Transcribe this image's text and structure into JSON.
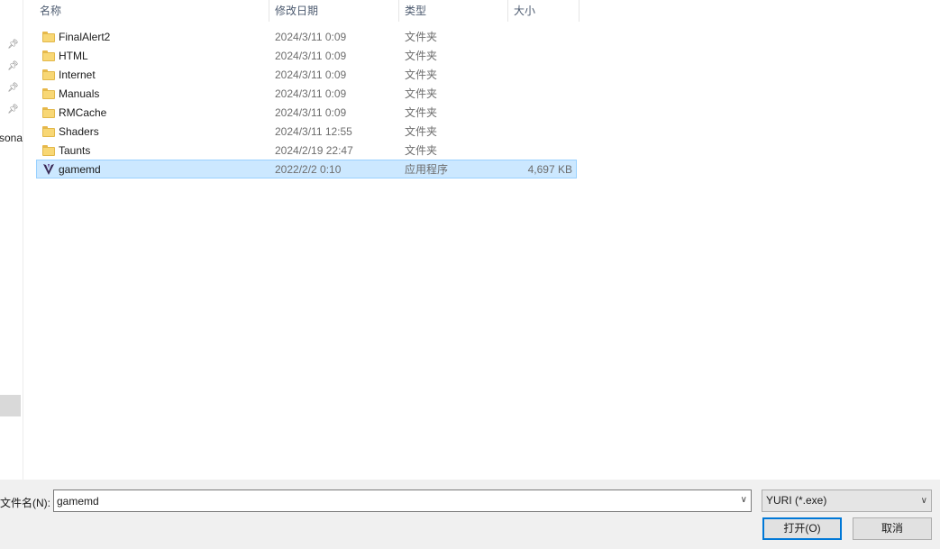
{
  "nav": {
    "partial_text": "sona"
  },
  "columns": {
    "name": "名称",
    "date": "修改日期",
    "type": "类型",
    "size": "大小"
  },
  "files": [
    {
      "name": "FinalAlert2",
      "date": "2024/3/11 0:09",
      "type": "文件夹",
      "size": "",
      "icon": "folder-icon"
    },
    {
      "name": "HTML",
      "date": "2024/3/11 0:09",
      "type": "文件夹",
      "size": "",
      "icon": "folder-icon"
    },
    {
      "name": "Internet",
      "date": "2024/3/11 0:09",
      "type": "文件夹",
      "size": "",
      "icon": "folder-icon"
    },
    {
      "name": "Manuals",
      "date": "2024/3/11 0:09",
      "type": "文件夹",
      "size": "",
      "icon": "folder-icon"
    },
    {
      "name": "RMCache",
      "date": "2024/3/11 0:09",
      "type": "文件夹",
      "size": "",
      "icon": "folder-icon"
    },
    {
      "name": "Shaders",
      "date": "2024/3/11 12:55",
      "type": "文件夹",
      "size": "",
      "icon": "folder-icon"
    },
    {
      "name": "Taunts",
      "date": "2024/2/19 22:47",
      "type": "文件夹",
      "size": "",
      "icon": "folder-icon"
    },
    {
      "name": "gamemd",
      "date": "2022/2/2 0:10",
      "type": "应用程序",
      "size": "4,697 KB",
      "icon": "yuri-app-icon",
      "selected": true
    }
  ],
  "footer": {
    "filename_label": "文件名(N):",
    "filename_value": "gamemd",
    "filetype_value": "YURI (*.exe)",
    "open_label": "打开(O)",
    "cancel_label": "取消"
  },
  "colors": {
    "selection_bg": "#cce8ff",
    "selection_border": "#99d1ff",
    "folder_yellow": "#f8d775",
    "accent": "#0078d7"
  }
}
